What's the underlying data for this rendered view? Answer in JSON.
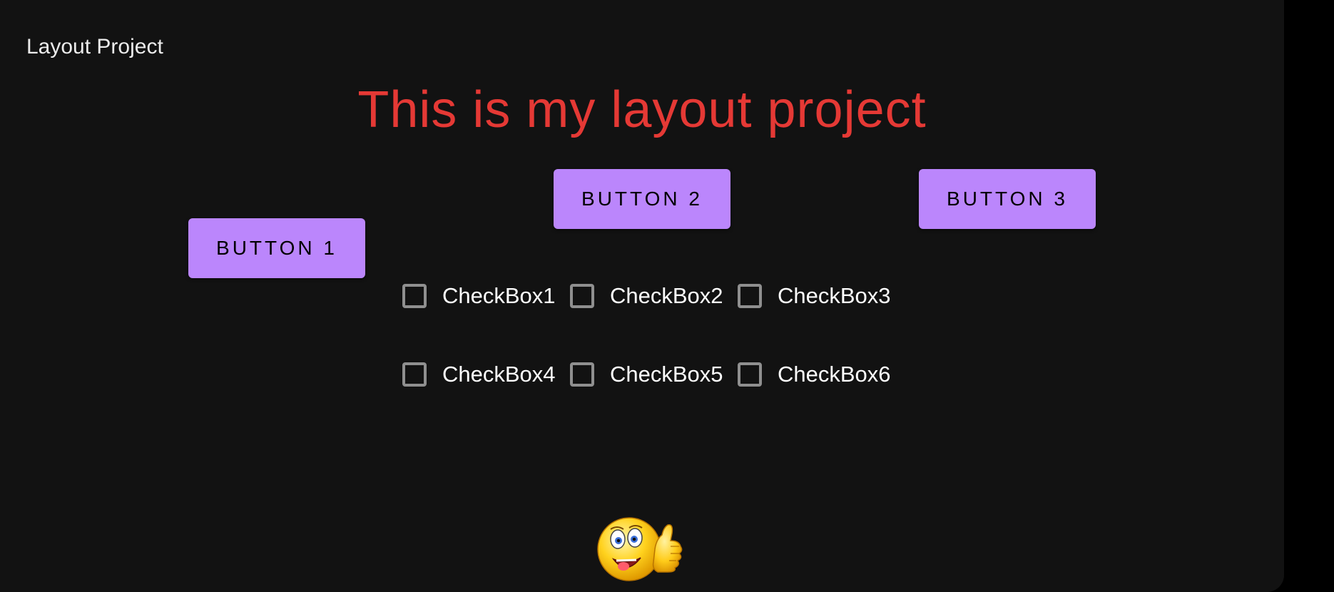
{
  "app_bar": {
    "title": "Layout Project"
  },
  "headline": "This is my layout project",
  "buttons": {
    "button1": "BUTTON 1",
    "button2": "BUTTON 2",
    "button3": "BUTTON 3"
  },
  "checkboxes": [
    {
      "label": "CheckBox1",
      "checked": false
    },
    {
      "label": "CheckBox2",
      "checked": false
    },
    {
      "label": "CheckBox3",
      "checked": false
    },
    {
      "label": "CheckBox4",
      "checked": false
    },
    {
      "label": "CheckBox5",
      "checked": false
    },
    {
      "label": "CheckBox6",
      "checked": false
    }
  ],
  "image": {
    "icon": "thumbs-up-smiley-icon"
  },
  "colors": {
    "background": "#121212",
    "headline": "#e53935",
    "button": "#bb86fc",
    "checkbox_border": "#8f8f8f"
  }
}
